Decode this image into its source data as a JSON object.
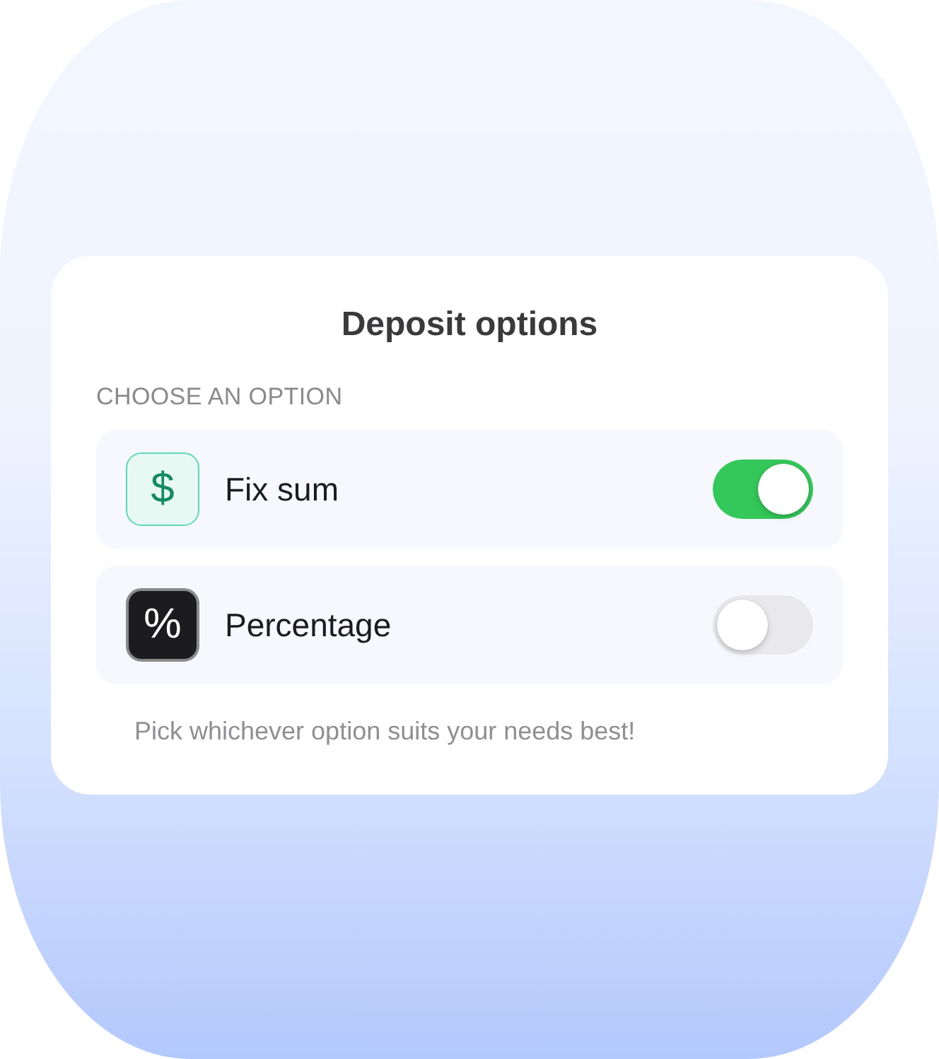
{
  "title": "Deposit options",
  "section_label": "CHOOSE AN OPTION",
  "options": [
    {
      "kind": "money",
      "icon": "$",
      "label": "Fix sum",
      "on": true
    },
    {
      "kind": "percent",
      "icon": "%",
      "label": "Percentage",
      "on": false
    }
  ],
  "footnote": "Pick whichever option suits your needs best!"
}
